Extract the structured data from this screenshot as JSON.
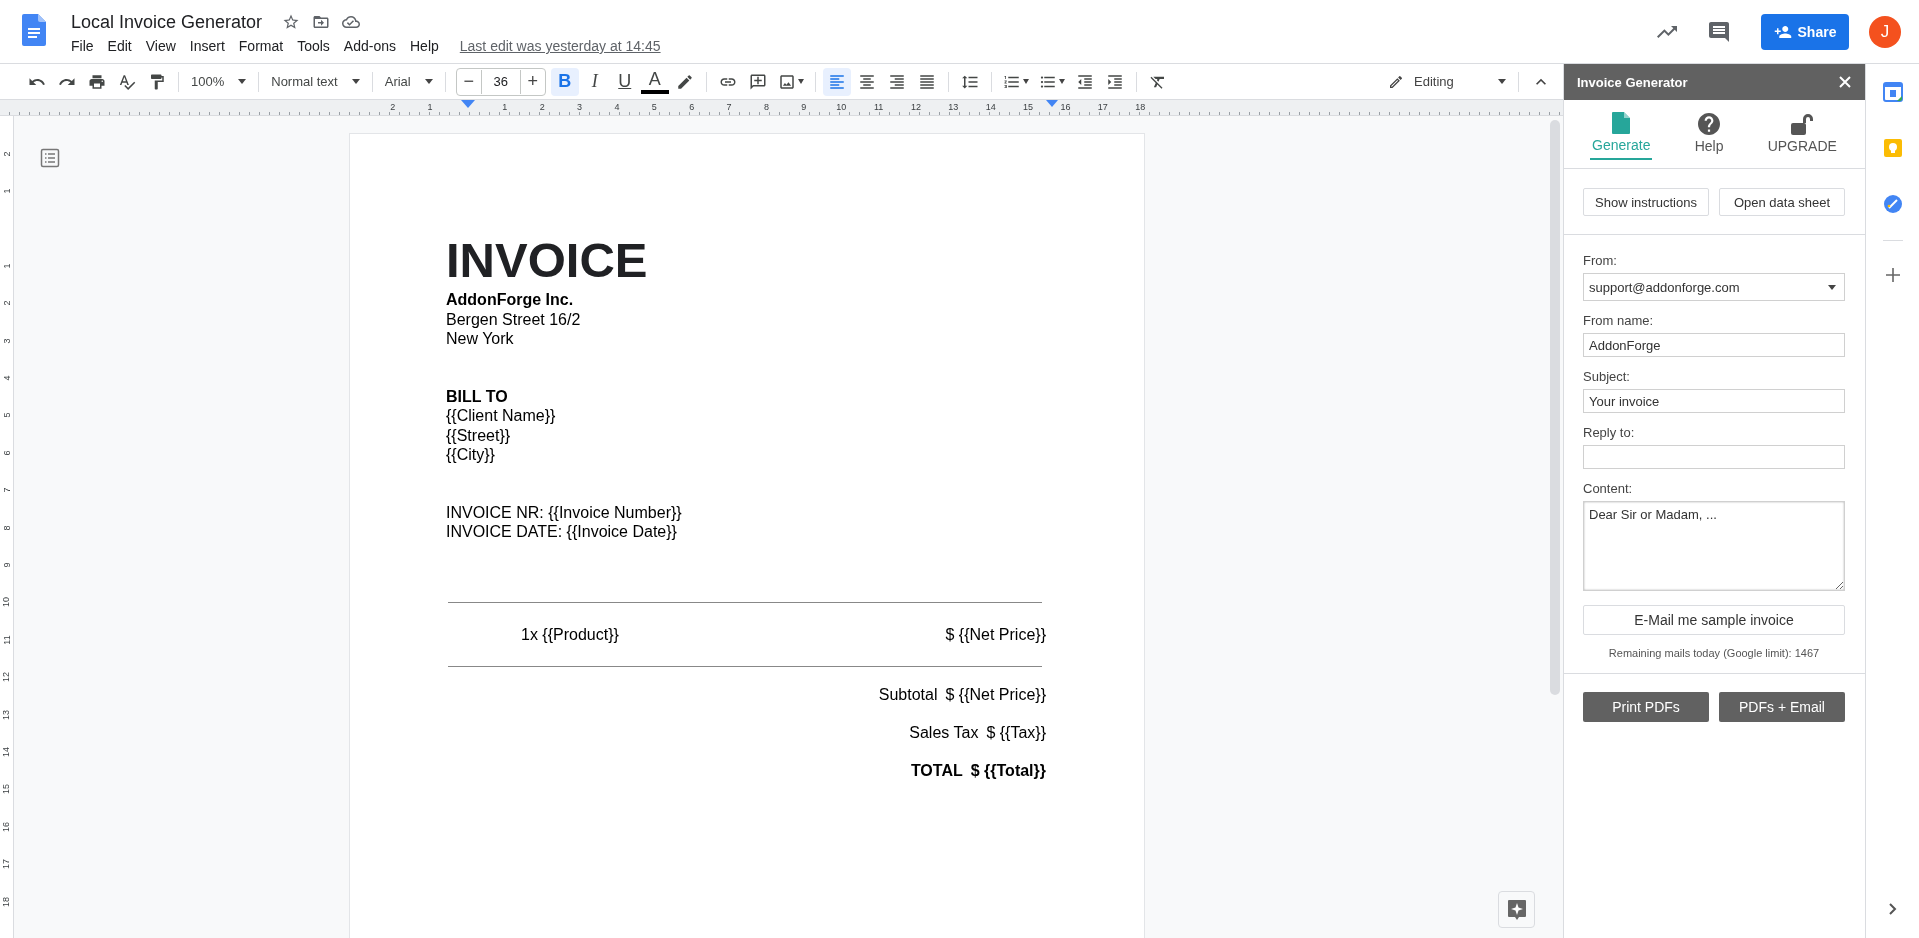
{
  "app": {
    "title": "Local Invoice Generator",
    "menu": [
      "File",
      "Edit",
      "View",
      "Insert",
      "Format",
      "Tools",
      "Add-ons",
      "Help"
    ],
    "last_edit": "Last edit was yesterday at 14:45",
    "share": "Share",
    "avatar": "J"
  },
  "toolbar": {
    "items": [
      {
        "kind": "undo"
      },
      {
        "kind": "redo"
      },
      {
        "kind": "print"
      },
      {
        "kind": "spellcheck"
      },
      {
        "kind": "paint-format"
      },
      {
        "kind": "separator"
      },
      {
        "kind": "dropdown",
        "label": "100%"
      },
      {
        "kind": "separator"
      },
      {
        "kind": "dropdown",
        "label": "Normal text"
      },
      {
        "kind": "separator"
      },
      {
        "kind": "dropdown",
        "label": "Arial"
      },
      {
        "kind": "separator"
      },
      {
        "kind": "stepper",
        "minus": "−",
        "value": "36",
        "plus": "+"
      },
      {
        "kind": "bold",
        "label": "B",
        "selected": true
      },
      {
        "kind": "italic",
        "label": "I",
        "selected": false
      },
      {
        "kind": "underline",
        "label": "U",
        "selected": false
      },
      {
        "kind": "text-color",
        "label": "A"
      },
      {
        "kind": "highlight"
      },
      {
        "kind": "separator"
      },
      {
        "kind": "link"
      },
      {
        "kind": "comment"
      },
      {
        "kind": "image"
      },
      {
        "kind": "separator"
      },
      {
        "kind": "align-left",
        "selected": true
      },
      {
        "kind": "align-center",
        "selected": false
      },
      {
        "kind": "align-right",
        "selected": false
      },
      {
        "kind": "align-justify",
        "selected": false
      },
      {
        "kind": "separator"
      },
      {
        "kind": "line-spacing"
      },
      {
        "kind": "separator"
      },
      {
        "kind": "numbered-list"
      },
      {
        "kind": "bulleted-list"
      },
      {
        "kind": "indent-decrease"
      },
      {
        "kind": "indent-increase"
      },
      {
        "kind": "separator"
      },
      {
        "kind": "clear-format"
      }
    ],
    "mode": "Editing"
  },
  "ruler": {
    "before": [
      "2",
      "1"
    ],
    "after": [
      "1",
      "2",
      "3",
      "4",
      "5",
      "6",
      "7",
      "8",
      "9",
      "10",
      "11",
      "12",
      "13",
      "14",
      "15",
      "16",
      "17",
      "18"
    ]
  },
  "vruler": {
    "before": [
      "2",
      "1"
    ],
    "after": [
      "1",
      "2",
      "3",
      "4",
      "5",
      "6",
      "7",
      "8",
      "9",
      "10",
      "11",
      "12",
      "13",
      "14",
      "15",
      "16",
      "17",
      "18"
    ]
  },
  "document": {
    "heading": "INVOICE",
    "sender": {
      "name": "AddonForge Inc.",
      "lines": [
        "Bergen Street 16/2",
        "New York"
      ]
    },
    "bill_to": {
      "title": "BILL TO",
      "lines": [
        "{{Client Name}}",
        "{{Street}}",
        "{{City}}"
      ]
    },
    "info": [
      "INVOICE NR: {{Invoice Number}}",
      "INVOICE DATE: {{Invoice Date}}"
    ],
    "items": [
      {
        "description": "1x {{Product}}",
        "price": "$ {{Net Price}}"
      }
    ],
    "totals": [
      {
        "label": "Subtotal",
        "value": "$ {{Net Price}}",
        "bold": false
      },
      {
        "label": "Sales Tax",
        "value": "$ {{Tax}}",
        "bold": false
      },
      {
        "label": "TOTAL",
        "value": "$ {{Total}}",
        "bold": true
      }
    ]
  },
  "panel": {
    "title": "Invoice Generator",
    "tabs": [
      {
        "label": "Generate",
        "kind": "document",
        "selected": true
      },
      {
        "label": "Help",
        "kind": "help",
        "selected": false
      },
      {
        "label": "UPGRADE",
        "kind": "unlock",
        "selected": false
      }
    ],
    "actions": [
      "Show instructions",
      "Open data sheet"
    ],
    "fields": [
      {
        "kind": "select",
        "label": "From:",
        "value": "support@addonforge.com"
      },
      {
        "kind": "text",
        "label": "From name:",
        "value": "AddonForge"
      },
      {
        "kind": "text",
        "label": "Subject:",
        "value": "Your invoice"
      },
      {
        "kind": "text",
        "label": "Reply to:"
      },
      {
        "kind": "textarea",
        "label": "Content:",
        "value": "Dear Sir or Madam, ..."
      }
    ],
    "sample_button": "E-Mail me sample invoice",
    "quota": "Remaining mails today (Google limit): 1467",
    "bottom_buttons": [
      "Print PDFs",
      "PDFs + Email"
    ]
  }
}
